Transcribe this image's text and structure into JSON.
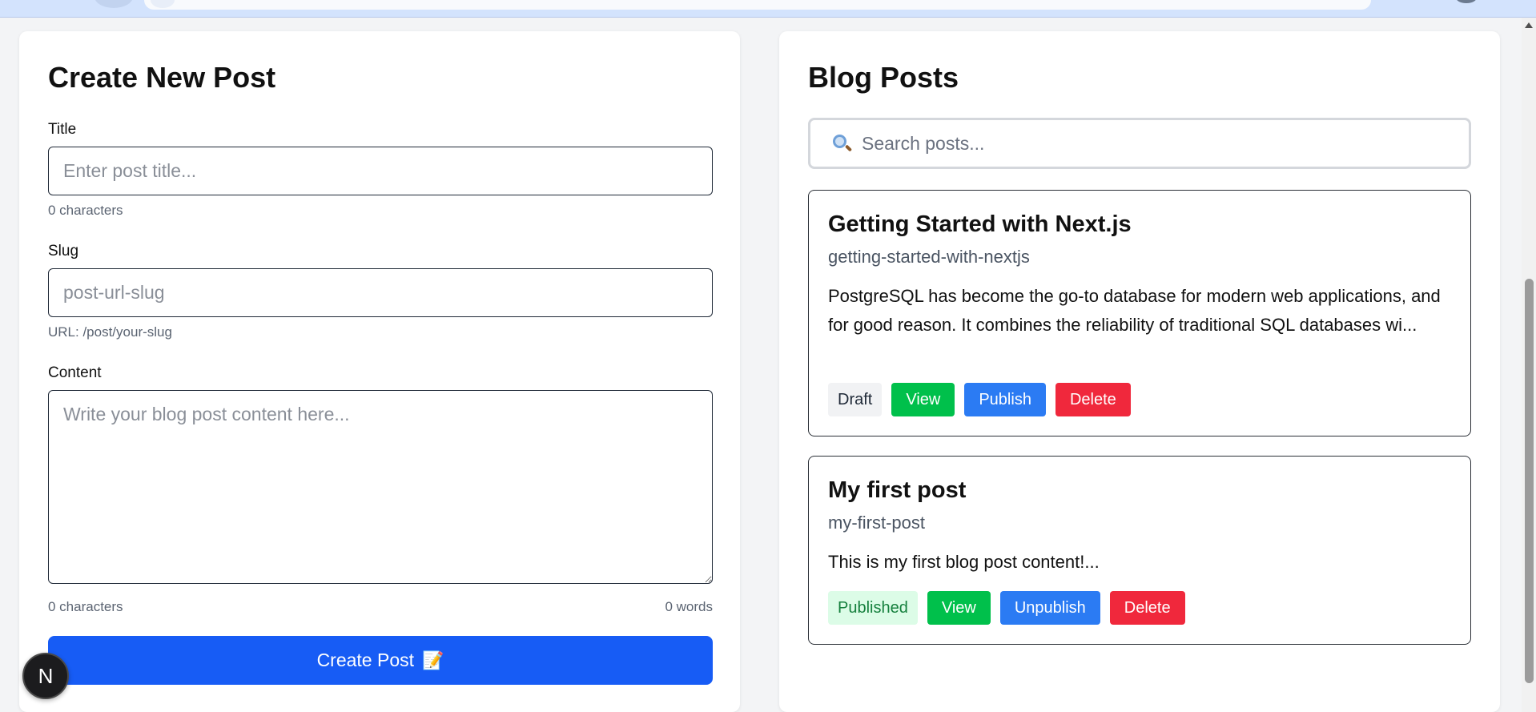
{
  "create_form": {
    "heading": "Create New Post",
    "title_field": {
      "label": "Title",
      "placeholder": "Enter post title...",
      "counter": "0 characters"
    },
    "slug_field": {
      "label": "Slug",
      "placeholder": "post-url-slug",
      "hint": "URL: /post/your-slug"
    },
    "content_field": {
      "label": "Content",
      "placeholder": "Write your blog post content here...",
      "char_counter": "0 characters",
      "word_counter": "0 words"
    },
    "submit_label": "Create Post",
    "submit_icon": "📝"
  },
  "next_badge": {
    "letter": "N"
  },
  "blog_list": {
    "heading": "Blog Posts",
    "search_placeholder": "Search posts...",
    "posts": [
      {
        "title": "Getting Started with Next.js",
        "slug": "getting-started-with-nextjs",
        "excerpt": "PostgreSQL has become the go-to database for modern web applications, and for good reason. It combines the reliability of traditional SQL databases wi...",
        "status": "Draft",
        "view_label": "View",
        "toggle_label": "Publish",
        "delete_label": "Delete"
      },
      {
        "title": "My first post",
        "slug": "my-first-post",
        "excerpt": "This is my first blog post content!...",
        "status": "Published",
        "view_label": "View",
        "toggle_label": "Unpublish",
        "delete_label": "Delete"
      }
    ]
  },
  "colors": {
    "primary_button": "#175cf5",
    "view_button": "#00c04b",
    "publish_button": "#2b7bf3",
    "delete_button": "#f0283c",
    "draft_badge_bg": "#f1f2f4",
    "published_badge_bg": "#dcfce7",
    "published_badge_text": "#15803d"
  }
}
